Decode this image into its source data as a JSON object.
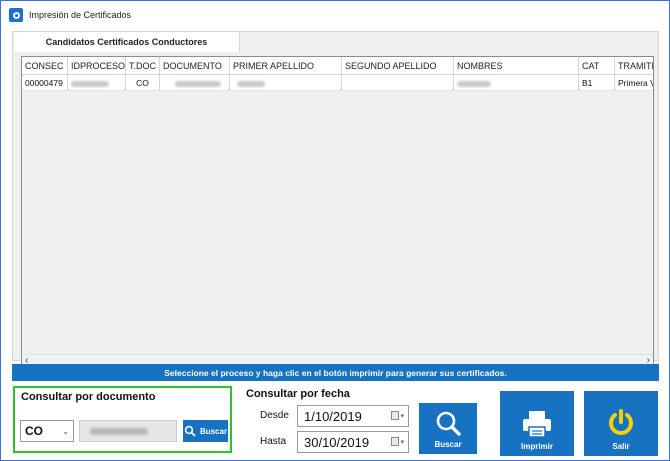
{
  "window": {
    "title": "Impresión de Certificados"
  },
  "tab": {
    "label": "Candidatos Certificados Conductores"
  },
  "grid": {
    "columns": [
      "CONSEC",
      "IDPROCESO",
      "T.DOC",
      "DOCUMENTO",
      "PRIMER APELLIDO",
      "SEGUNDO APELLIDO",
      "NOMBRES",
      "CAT",
      "TRAMITE"
    ],
    "rows": [
      {
        "consec": "00000479",
        "tdoc": "CO",
        "cat": "B1",
        "tramite": "Primera Ve"
      }
    ]
  },
  "message": "Seleccione el proceso y haga clic en el botón imprimir para generar sus certificados.",
  "consultar_documento": {
    "title": "Consultar por documento",
    "tipo_documento": "CO",
    "buscar_label": "Buscar"
  },
  "consultar_fecha": {
    "title": "Consultar por fecha",
    "desde_label": "Desde",
    "desde_value": "1/10/2019",
    "hasta_label": "Hasta",
    "hasta_value": "30/10/2019"
  },
  "actions": {
    "buscar_label": "Buscar",
    "imprimir_label": "Imprimir",
    "salir_label": "Salir"
  },
  "colors": {
    "accent": "#1772c2",
    "group_highlight": "#2fc22b",
    "salir_icon": "#f5d100"
  }
}
